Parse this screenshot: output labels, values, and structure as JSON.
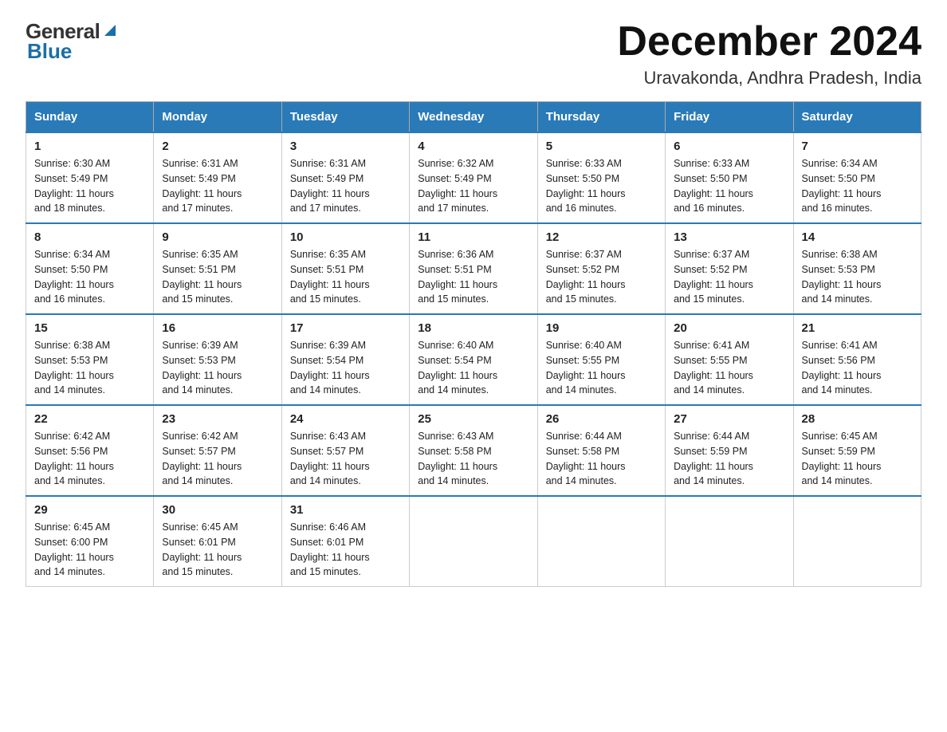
{
  "header": {
    "logo_general": "General",
    "logo_blue": "Blue",
    "title": "December 2024",
    "subtitle": "Uravakonda, Andhra Pradesh, India"
  },
  "days_of_week": [
    "Sunday",
    "Monday",
    "Tuesday",
    "Wednesday",
    "Thursday",
    "Friday",
    "Saturday"
  ],
  "weeks": [
    [
      {
        "num": "1",
        "sunrise": "6:30 AM",
        "sunset": "5:49 PM",
        "daylight": "11 hours and 18 minutes."
      },
      {
        "num": "2",
        "sunrise": "6:31 AM",
        "sunset": "5:49 PM",
        "daylight": "11 hours and 17 minutes."
      },
      {
        "num": "3",
        "sunrise": "6:31 AM",
        "sunset": "5:49 PM",
        "daylight": "11 hours and 17 minutes."
      },
      {
        "num": "4",
        "sunrise": "6:32 AM",
        "sunset": "5:49 PM",
        "daylight": "11 hours and 17 minutes."
      },
      {
        "num": "5",
        "sunrise": "6:33 AM",
        "sunset": "5:50 PM",
        "daylight": "11 hours and 16 minutes."
      },
      {
        "num": "6",
        "sunrise": "6:33 AM",
        "sunset": "5:50 PM",
        "daylight": "11 hours and 16 minutes."
      },
      {
        "num": "7",
        "sunrise": "6:34 AM",
        "sunset": "5:50 PM",
        "daylight": "11 hours and 16 minutes."
      }
    ],
    [
      {
        "num": "8",
        "sunrise": "6:34 AM",
        "sunset": "5:50 PM",
        "daylight": "11 hours and 16 minutes."
      },
      {
        "num": "9",
        "sunrise": "6:35 AM",
        "sunset": "5:51 PM",
        "daylight": "11 hours and 15 minutes."
      },
      {
        "num": "10",
        "sunrise": "6:35 AM",
        "sunset": "5:51 PM",
        "daylight": "11 hours and 15 minutes."
      },
      {
        "num": "11",
        "sunrise": "6:36 AM",
        "sunset": "5:51 PM",
        "daylight": "11 hours and 15 minutes."
      },
      {
        "num": "12",
        "sunrise": "6:37 AM",
        "sunset": "5:52 PM",
        "daylight": "11 hours and 15 minutes."
      },
      {
        "num": "13",
        "sunrise": "6:37 AM",
        "sunset": "5:52 PM",
        "daylight": "11 hours and 15 minutes."
      },
      {
        "num": "14",
        "sunrise": "6:38 AM",
        "sunset": "5:53 PM",
        "daylight": "11 hours and 14 minutes."
      }
    ],
    [
      {
        "num": "15",
        "sunrise": "6:38 AM",
        "sunset": "5:53 PM",
        "daylight": "11 hours and 14 minutes."
      },
      {
        "num": "16",
        "sunrise": "6:39 AM",
        "sunset": "5:53 PM",
        "daylight": "11 hours and 14 minutes."
      },
      {
        "num": "17",
        "sunrise": "6:39 AM",
        "sunset": "5:54 PM",
        "daylight": "11 hours and 14 minutes."
      },
      {
        "num": "18",
        "sunrise": "6:40 AM",
        "sunset": "5:54 PM",
        "daylight": "11 hours and 14 minutes."
      },
      {
        "num": "19",
        "sunrise": "6:40 AM",
        "sunset": "5:55 PM",
        "daylight": "11 hours and 14 minutes."
      },
      {
        "num": "20",
        "sunrise": "6:41 AM",
        "sunset": "5:55 PM",
        "daylight": "11 hours and 14 minutes."
      },
      {
        "num": "21",
        "sunrise": "6:41 AM",
        "sunset": "5:56 PM",
        "daylight": "11 hours and 14 minutes."
      }
    ],
    [
      {
        "num": "22",
        "sunrise": "6:42 AM",
        "sunset": "5:56 PM",
        "daylight": "11 hours and 14 minutes."
      },
      {
        "num": "23",
        "sunrise": "6:42 AM",
        "sunset": "5:57 PM",
        "daylight": "11 hours and 14 minutes."
      },
      {
        "num": "24",
        "sunrise": "6:43 AM",
        "sunset": "5:57 PM",
        "daylight": "11 hours and 14 minutes."
      },
      {
        "num": "25",
        "sunrise": "6:43 AM",
        "sunset": "5:58 PM",
        "daylight": "11 hours and 14 minutes."
      },
      {
        "num": "26",
        "sunrise": "6:44 AM",
        "sunset": "5:58 PM",
        "daylight": "11 hours and 14 minutes."
      },
      {
        "num": "27",
        "sunrise": "6:44 AM",
        "sunset": "5:59 PM",
        "daylight": "11 hours and 14 minutes."
      },
      {
        "num": "28",
        "sunrise": "6:45 AM",
        "sunset": "5:59 PM",
        "daylight": "11 hours and 14 minutes."
      }
    ],
    [
      {
        "num": "29",
        "sunrise": "6:45 AM",
        "sunset": "6:00 PM",
        "daylight": "11 hours and 14 minutes."
      },
      {
        "num": "30",
        "sunrise": "6:45 AM",
        "sunset": "6:01 PM",
        "daylight": "11 hours and 15 minutes."
      },
      {
        "num": "31",
        "sunrise": "6:46 AM",
        "sunset": "6:01 PM",
        "daylight": "11 hours and 15 minutes."
      },
      null,
      null,
      null,
      null
    ]
  ],
  "labels": {
    "sunrise": "Sunrise:",
    "sunset": "Sunset:",
    "daylight": "Daylight:"
  }
}
